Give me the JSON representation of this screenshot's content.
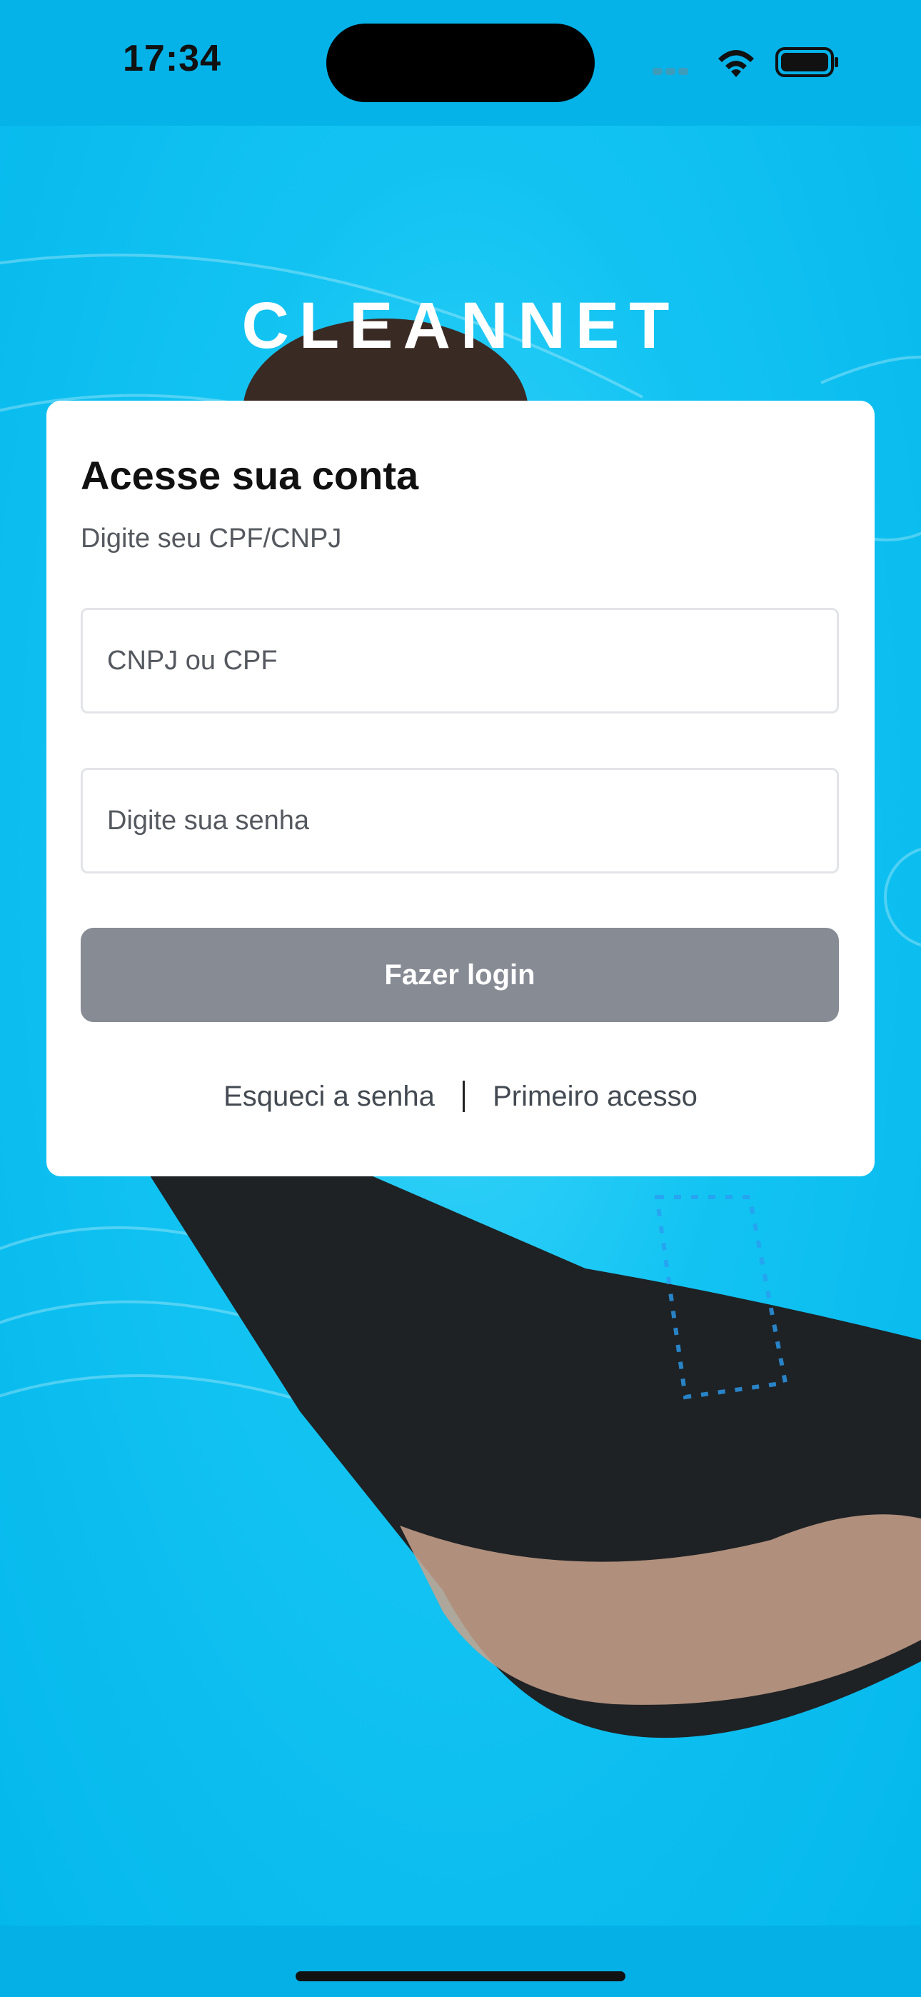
{
  "status_bar": {
    "time": "17:34",
    "icons": [
      "cellular-signal-icon",
      "wifi-icon",
      "battery-icon"
    ]
  },
  "brand": {
    "logo_text": "CLEANNET",
    "colors": {
      "background": "#06b8ec",
      "button_disabled": "#878b94",
      "card": "#ffffff"
    }
  },
  "login_card": {
    "title": "Acesse sua conta",
    "subtitle": "Digite seu CPF/CNPJ",
    "cpf_field": {
      "placeholder": "CNPJ ou CPF",
      "value": ""
    },
    "password_field": {
      "placeholder": "Digite sua senha",
      "value": ""
    },
    "login_button_label": "Fazer login",
    "forgot_password_label": "Esqueci a senha",
    "first_access_label": "Primeiro acesso"
  }
}
